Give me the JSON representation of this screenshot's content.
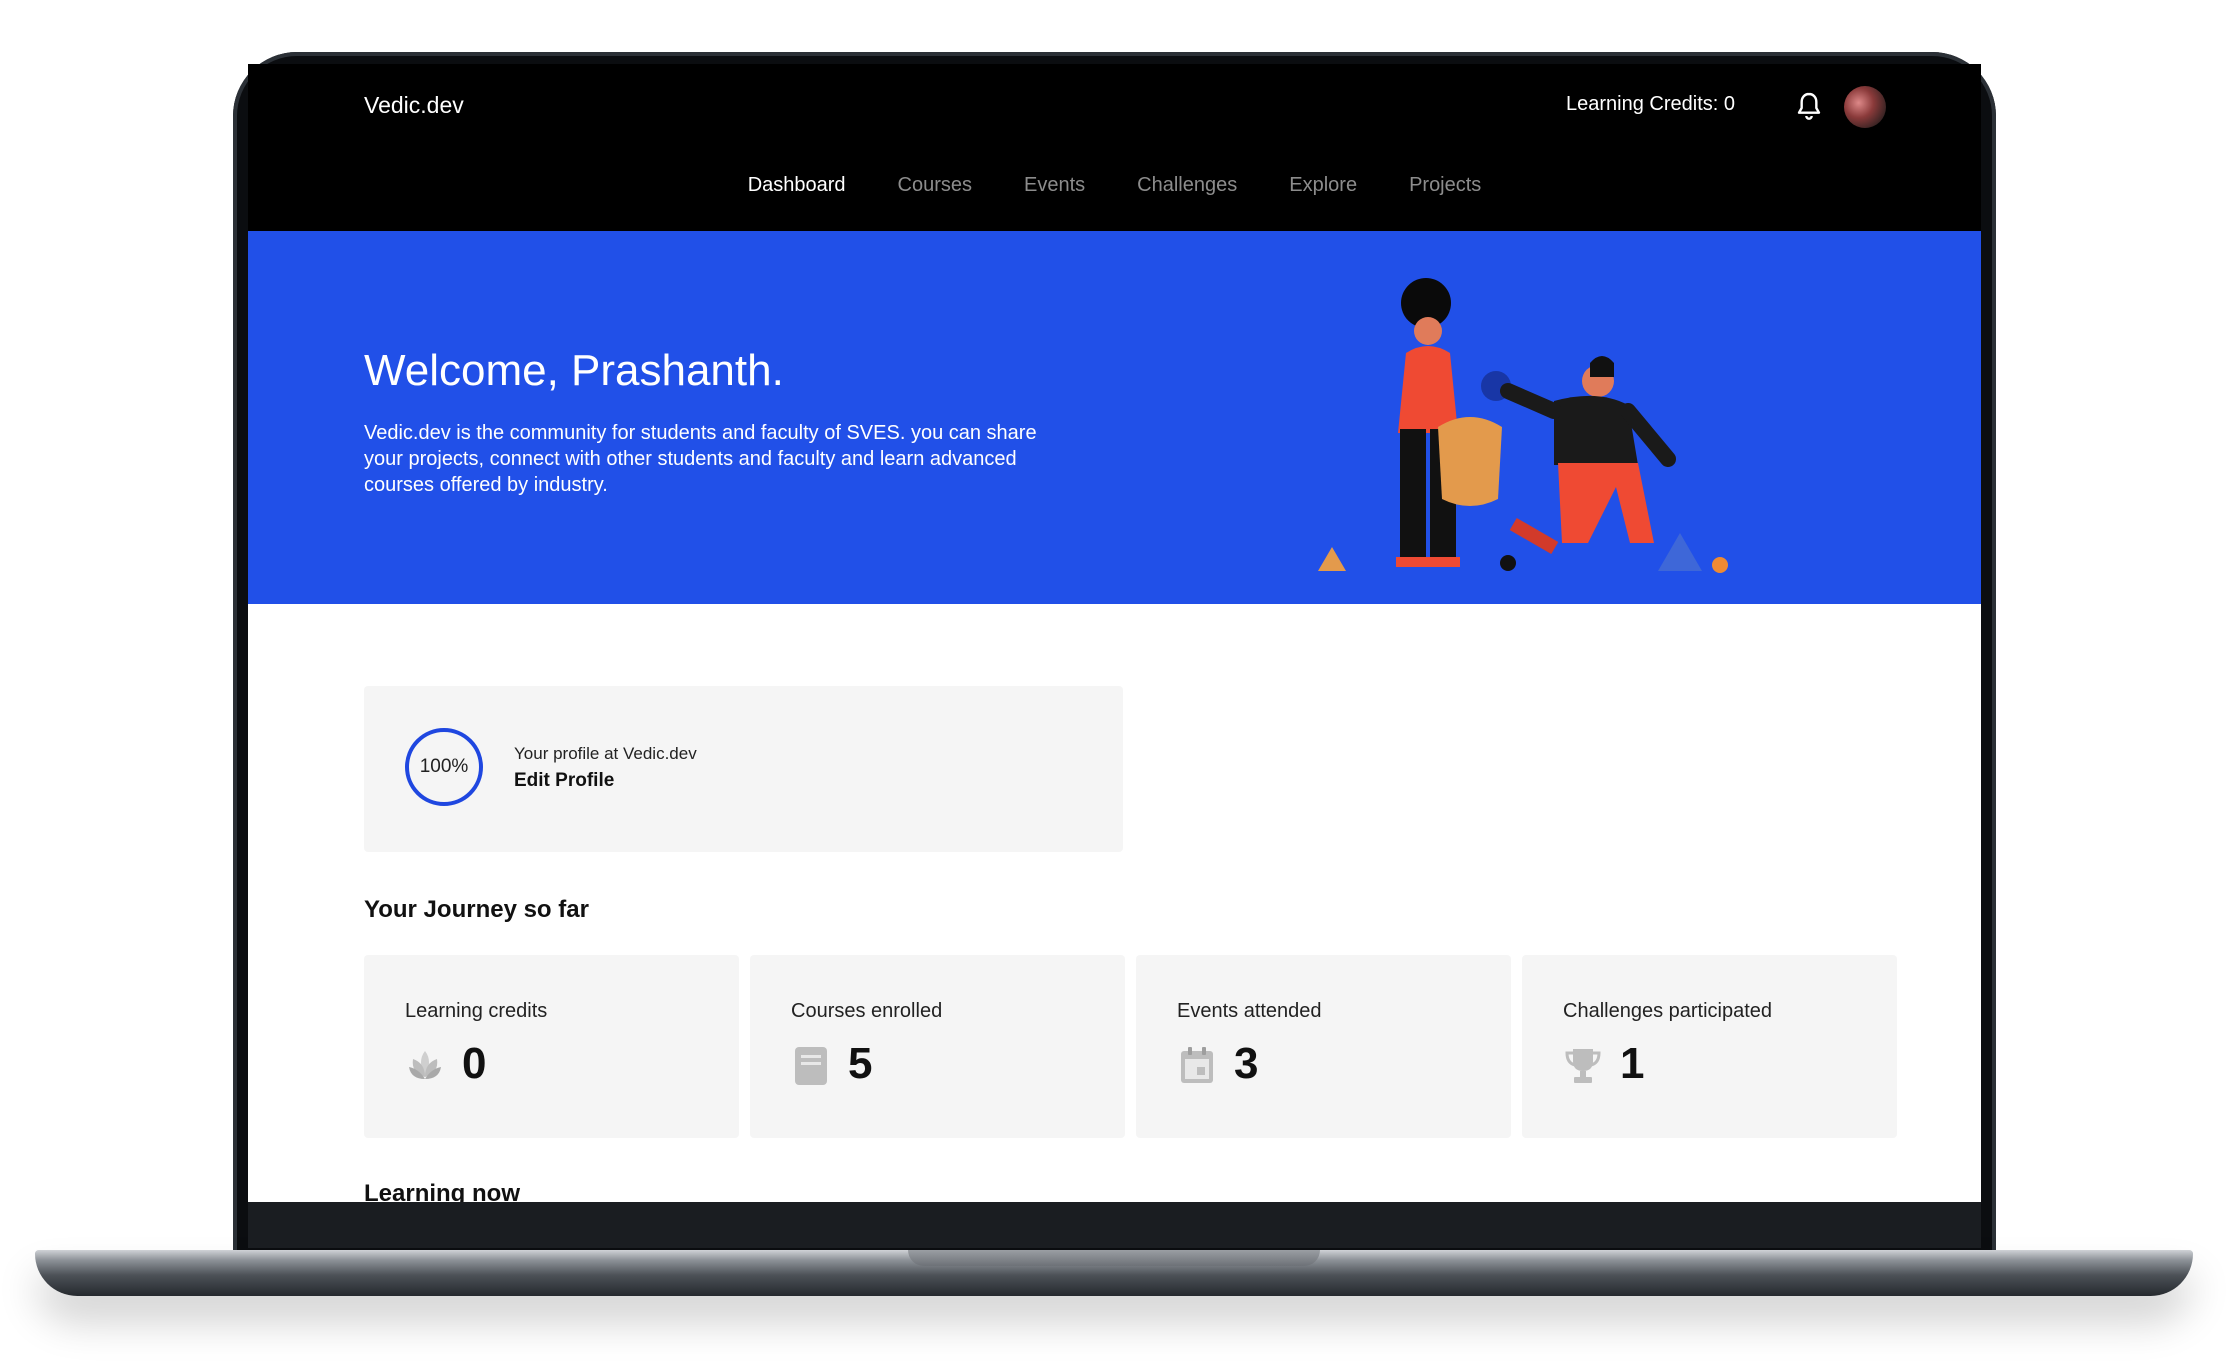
{
  "header": {
    "brand": "Vedic.dev",
    "credits_label": "Learning Credits:  0"
  },
  "nav": {
    "items": [
      "Dashboard",
      "Courses",
      "Events",
      "Challenges",
      "Explore",
      "Projects"
    ],
    "active": "Dashboard"
  },
  "hero": {
    "title": "Welcome, Prashanth.",
    "text": "Vedic.dev is the community for students and faculty of SVES. you can share your projects, connect with other students and faculty and learn advanced courses offered by industry."
  },
  "profile": {
    "percent": "100%",
    "subtitle": "Your profile at Vedic.dev",
    "edit_label": "Edit Profile"
  },
  "journey": {
    "title": "Your Journey so far",
    "stats": [
      {
        "label": "Learning credits",
        "value": "0",
        "icon": "lotus-icon"
      },
      {
        "label": "Courses enrolled",
        "value": "5",
        "icon": "book-icon"
      },
      {
        "label": "Events attended",
        "value": "3",
        "icon": "calendar-icon"
      },
      {
        "label": "Challenges participated",
        "value": "1",
        "icon": "trophy-icon"
      }
    ]
  },
  "learning_now": {
    "title": "Learning now"
  },
  "colors": {
    "accent": "#2150e8",
    "topbar": "#000000",
    "card": "#f5f5f5"
  }
}
